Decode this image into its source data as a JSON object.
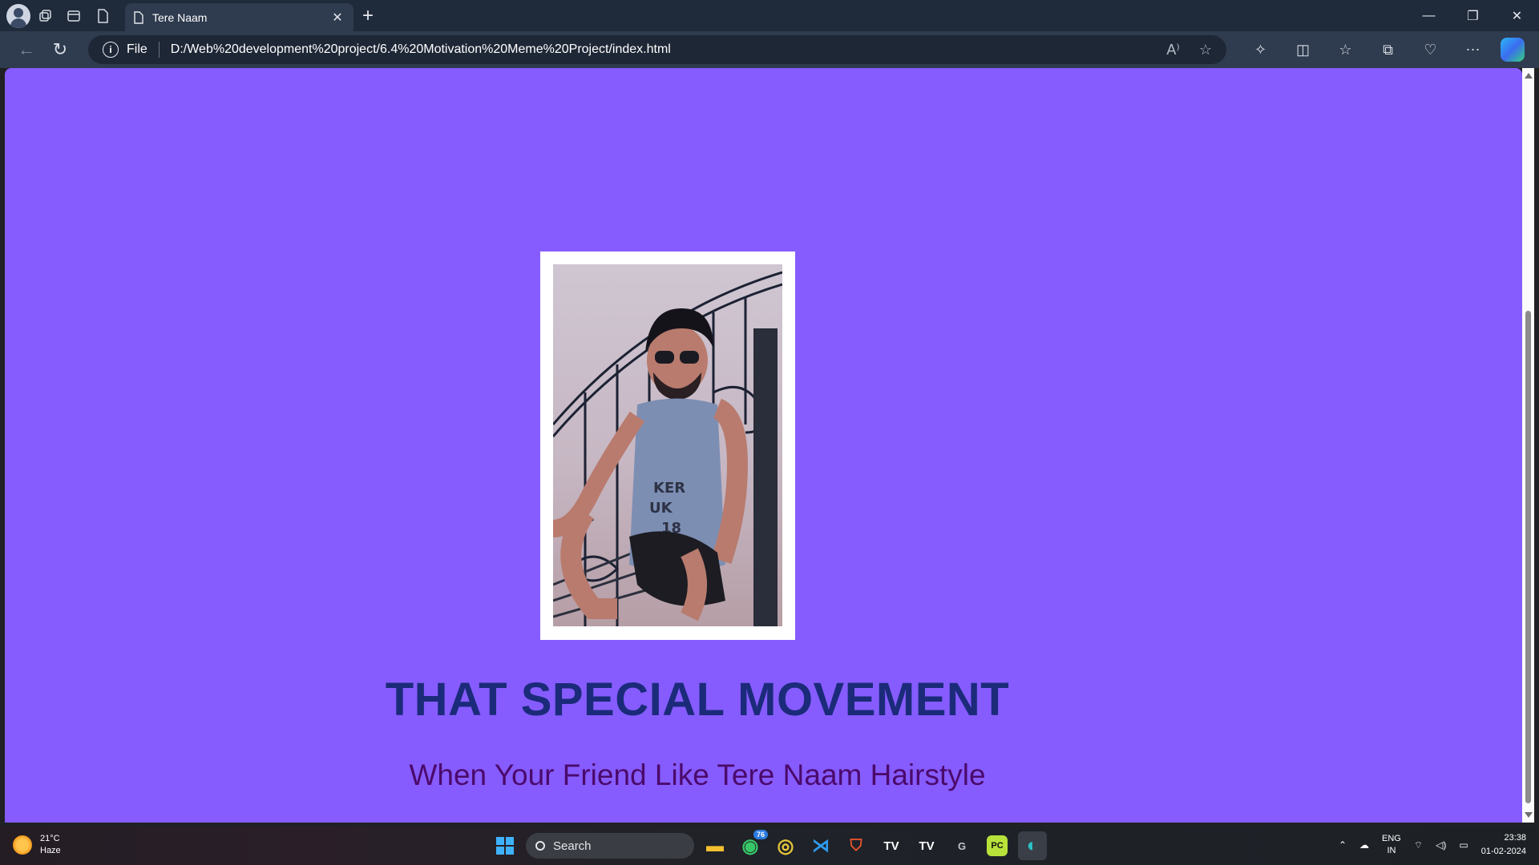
{
  "browser": {
    "tab": {
      "title": "Tere Naam"
    },
    "address": {
      "scheme": "File",
      "url": "D:/Web%20development%20project/6.4%20Motivation%20Meme%20Project/index.html"
    }
  },
  "page": {
    "heading": "THAT SPECIAL MOVEMENT",
    "subheading": "When Your Friend Like Tere Naam Hairstyle",
    "background_color": "#865cff",
    "heading_color": "#1b2b7a",
    "subheading_color": "#4b0a6b"
  },
  "taskbar": {
    "weather": {
      "temp": "21°C",
      "condition": "Haze"
    },
    "search_label": "Search",
    "whatsapp_badge": "76",
    "lang": {
      "line1": "ENG",
      "line2": "IN"
    },
    "clock": {
      "time": "23:38",
      "date": "01-02-2024"
    }
  }
}
